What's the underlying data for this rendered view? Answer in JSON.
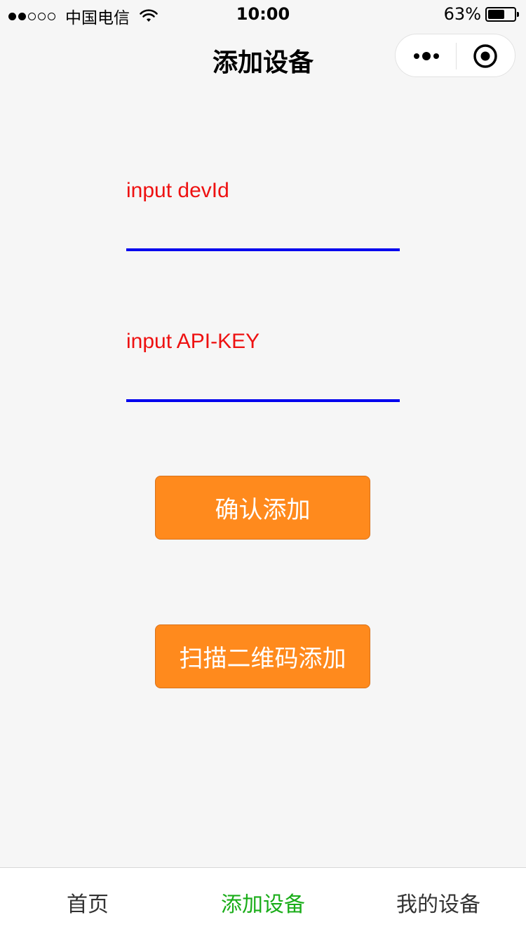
{
  "status_bar": {
    "carrier": "中国电信",
    "time": "10:00",
    "battery_percent": "63%",
    "battery_level": 0.63,
    "signal_strength": 2,
    "signal_max": 5
  },
  "nav": {
    "title": "添加设备",
    "capsule_icons": [
      "more-icon",
      "close-circle-icon"
    ]
  },
  "form": {
    "dev_id_label": "input devId",
    "dev_id_value": "",
    "api_key_label": "input API-KEY",
    "api_key_value": ""
  },
  "buttons": {
    "confirm_label": "确认添加",
    "scan_label": "扫描二维码添加"
  },
  "tabs": [
    {
      "label": "首页",
      "active": false
    },
    {
      "label": "添加设备",
      "active": true
    },
    {
      "label": "我的设备",
      "active": false
    }
  ],
  "colors": {
    "label": "#ee1111",
    "input_underline": "#0000ee",
    "button": "#ff8a1d",
    "tab_active": "#1aad19",
    "tab_inactive": "#333333"
  }
}
